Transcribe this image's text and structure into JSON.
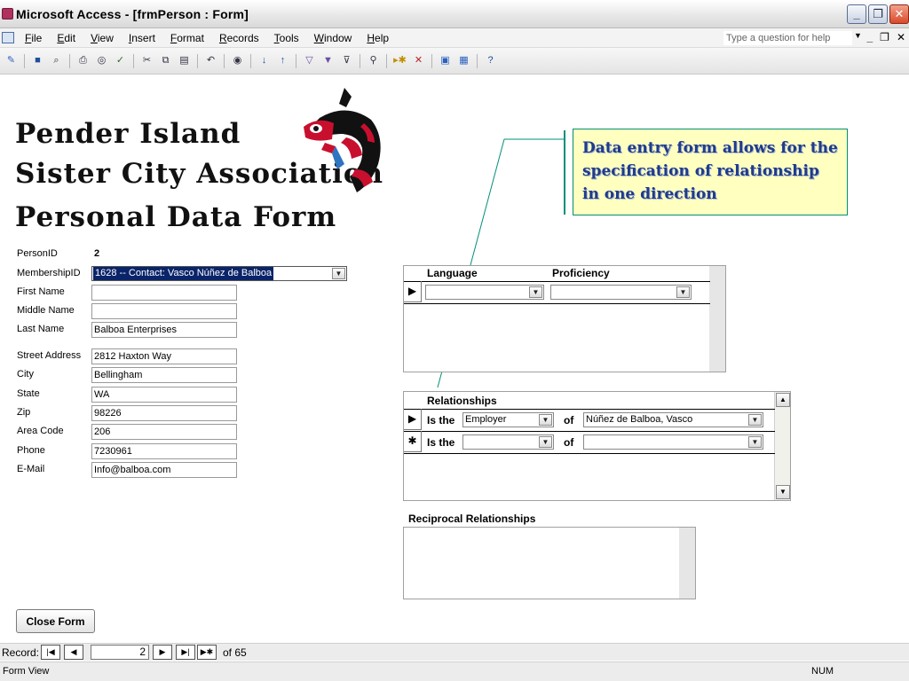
{
  "window": {
    "title": "Microsoft Access - [frmPerson : Form]"
  },
  "menu": {
    "items": [
      "File",
      "Edit",
      "View",
      "Insert",
      "Format",
      "Records",
      "Tools",
      "Window",
      "Help"
    ],
    "help_placeholder": "Type a question for help"
  },
  "heading": {
    "line1": "Pender Island",
    "line2": "Sister City Association",
    "line3": "Personal Data Form"
  },
  "form": {
    "person_id_label": "PersonID",
    "person_id": "2",
    "membership_label": "MembershipID",
    "membership": "1628 -- Contact: Vasco Núñez de Balboa",
    "first_name_label": "First Name",
    "first_name": "",
    "middle_name_label": "Middle Name",
    "middle_name": "",
    "last_name_label": "Last Name",
    "last_name": "Balboa Enterprises",
    "street_label": "Street Address",
    "street": "2812 Haxton Way",
    "city_label": "City",
    "city": "Bellingham",
    "state_label": "State",
    "state": "WA",
    "zip_label": "Zip",
    "zip": "98226",
    "area_code_label": "Area Code",
    "area_code": "206",
    "phone_label": "Phone",
    "phone": "7230961",
    "email_label": "E-Mail",
    "email": "Info@balboa.com",
    "close_label": "Close Form"
  },
  "callout": {
    "text": "Data entry form allows for the specification of relationship in one direction"
  },
  "languages": {
    "language_header": "Language",
    "proficiency_header": "Proficiency",
    "language_value": "",
    "proficiency_value": ""
  },
  "relationships": {
    "title": "Relationships",
    "is_the": "Is the",
    "of": "of",
    "row1_type": "Employer",
    "row1_person": "Núñez de Balboa, Vasco",
    "row2_type": "",
    "row2_person": ""
  },
  "reciprocal": {
    "title": "Reciprocal Relationships"
  },
  "nav": {
    "record_label": "Record:",
    "current": "2",
    "of_text": "of 65"
  },
  "status": {
    "view": "Form View",
    "num": "NUM"
  },
  "colors": {
    "callout_bg": "#ffffc0",
    "callout_text": "#1f3b8c",
    "accent": "#008f77",
    "selection": "#0a246a"
  }
}
